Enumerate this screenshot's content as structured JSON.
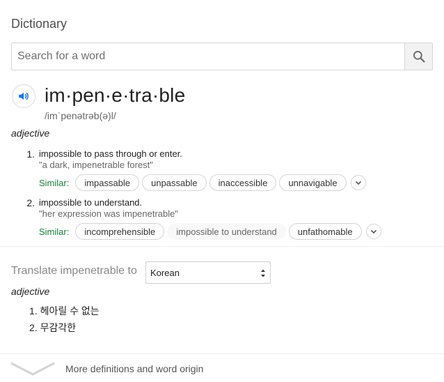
{
  "header": {
    "title": "Dictionary"
  },
  "search": {
    "placeholder": "Search for a word",
    "button_icon": "search-icon"
  },
  "entry": {
    "headword": "im·pen·e·tra·ble",
    "phonetic": "/imˈpenətrəb(ə)l/",
    "part_of_speech": "adjective",
    "speaker_icon": "speaker-icon",
    "accent_color": "#1a73e8",
    "definitions": [
      {
        "number": "1.",
        "text": "impossible to pass through or enter.",
        "example": "\"a dark, impenetrable forest\"",
        "similar_label": "Similar:",
        "similar": [
          "impassable",
          "unpassable",
          "inaccessible",
          "unnavigable"
        ]
      },
      {
        "number": "2.",
        "text": "impossible to understand.",
        "example": "\"her expression was impenetrable\"",
        "similar_label": "Similar:",
        "similar": [
          "incomprehensible",
          "impossible to understand",
          "unfathomable"
        ]
      }
    ]
  },
  "translate": {
    "label": "Translate impenetrable to",
    "language": "Korean",
    "part_of_speech": "adjective",
    "items": [
      {
        "number": "1.",
        "text": "헤아릴 수 없는"
      },
      {
        "number": "2.",
        "text": "무감각한"
      }
    ]
  },
  "footer": {
    "more_label": "More definitions and word origin"
  }
}
